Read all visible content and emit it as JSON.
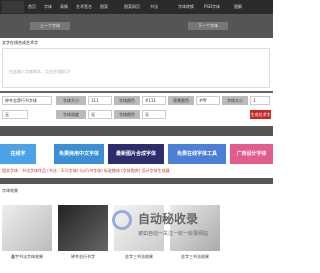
{
  "nav": {
    "logo_alt": "",
    "items": [
      "首页",
      "字体",
      "表情",
      "艺术签名",
      "图案",
      "图案网页",
      "书法",
      "字体转换",
      "PSD字体",
      "图解"
    ]
  },
  "subbar": {
    "prev_label": "上一个字体",
    "next_label": "下一个字体"
  },
  "title_line": "文字在线合成艺术字",
  "input_placeholder": "在此输入字体样本，点击生成即可！",
  "controls": {
    "font_select": "钟齐志莽行书字体",
    "size_label": "字体大小",
    "size_value": "111",
    "color_label": "字体颜色",
    "color_value": "#111",
    "bg_label": "背景颜色",
    "bg_value": "#fff",
    "pad_label": "字体大小",
    "pad_value": "1",
    "row2_a": "无",
    "row2_b_label": "字体深度",
    "row2_c": "无",
    "row2_d_label": "字体颜色",
    "row2_e": "无",
    "generate_label": "生成艺术字"
  },
  "banners": [
    {
      "text": "在线字",
      "color": "#4aa3e8"
    },
    {
      "text": "免费商用中文字体",
      "color": "#3a8fd6"
    },
    {
      "text": "最新图片合成字体",
      "color": "#2d2d6e"
    },
    {
      "text": "免费在线字体工具",
      "color": "#4d7fd9"
    },
    {
      "text": "广西设计字体",
      "color": "#e35b8f"
    }
  ],
  "breadcrumb": "相关字体：书法字体作品  (书法 : 天马字体)  (以行书字体) 标准楷体  (字体图库) 设计字体生成器",
  "section_title": "字体效果",
  "thumbs": [
    {
      "caption": "鑫宇书法字体效果"
    },
    {
      "caption": "钟齐志行书字"
    },
    {
      "caption": "金字三书法效果"
    },
    {
      "caption": "金字三书法效果"
    }
  ],
  "watermark": {
    "title": "自动秘收录",
    "subtitle": "被如自动一关注一收一收录网站"
  },
  "colors": {
    "accent": "#c62828",
    "dark": "#2b2b2b"
  }
}
